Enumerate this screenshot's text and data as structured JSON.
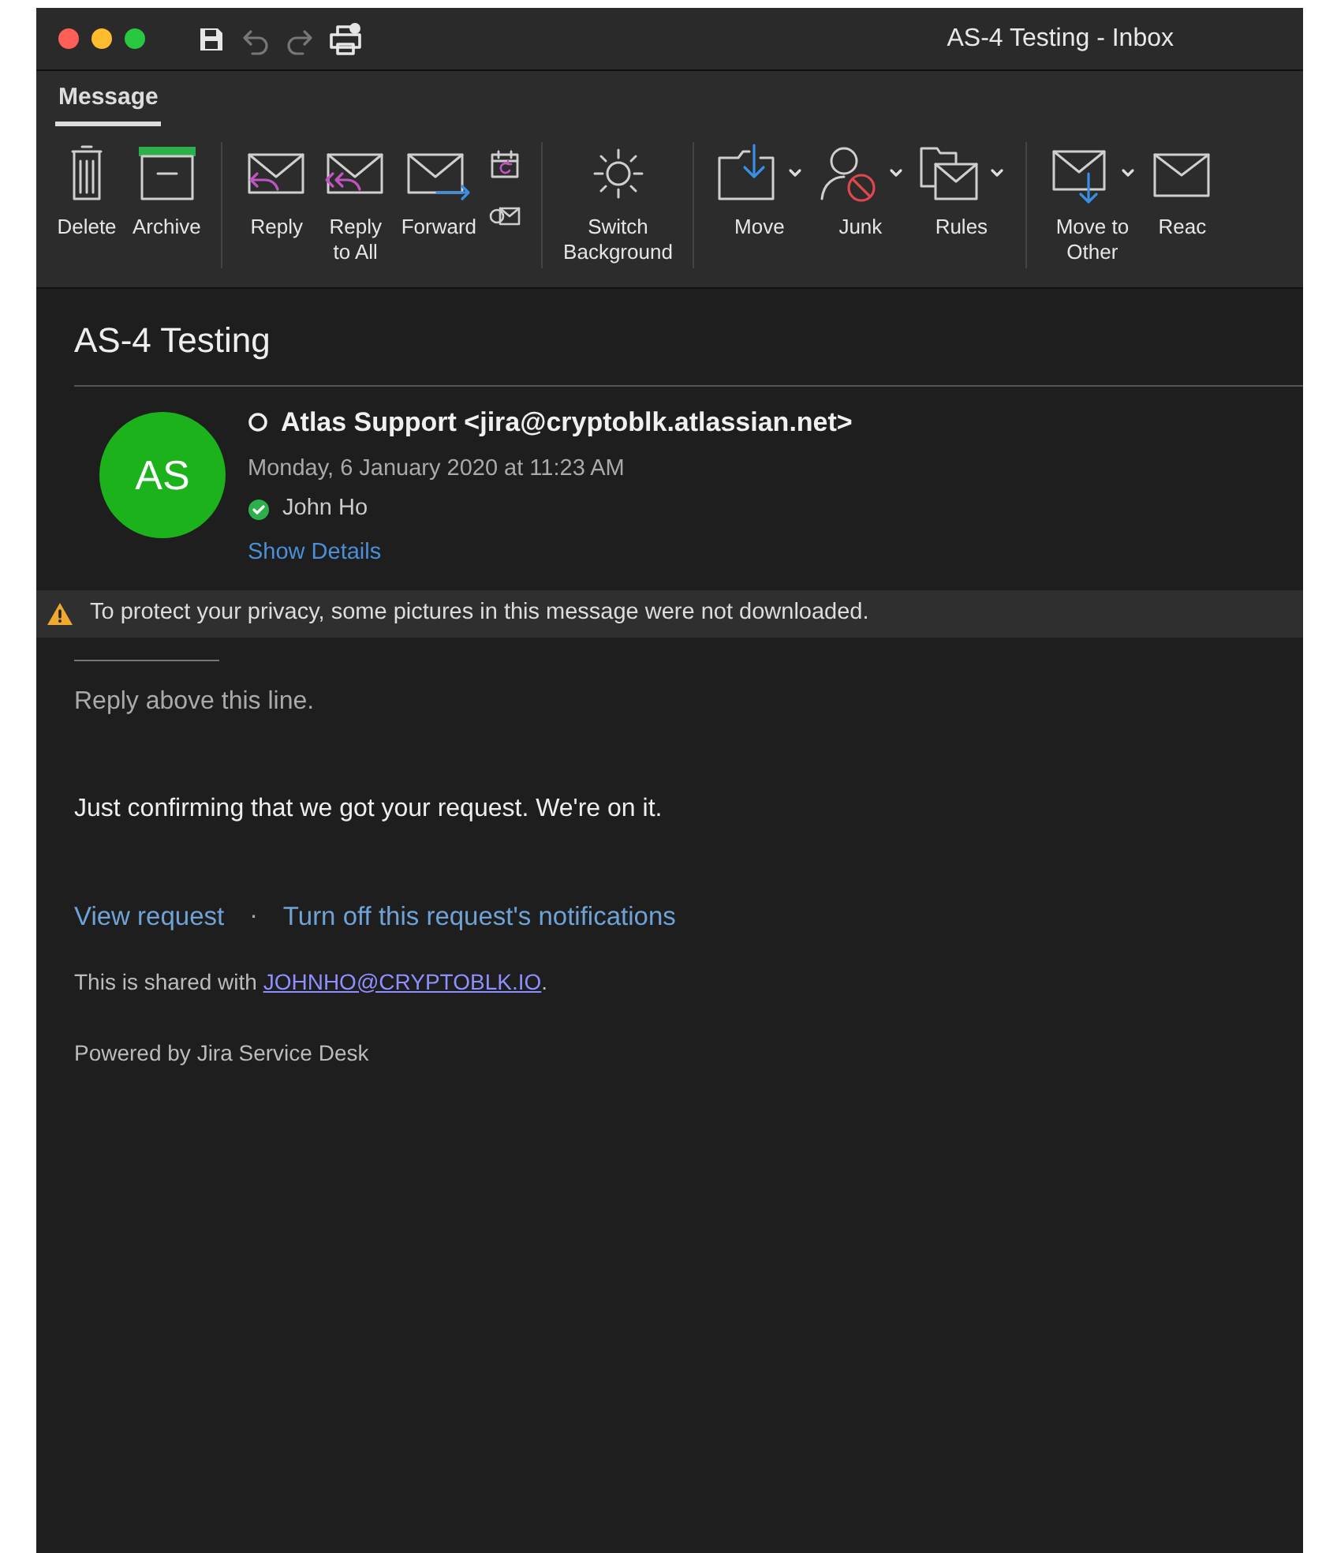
{
  "window": {
    "title": "AS-4 Testing - Inbox"
  },
  "ribbon_tabs": [
    {
      "label": "Message",
      "selected": true
    }
  ],
  "ribbon_groups": [
    {
      "buttons": [
        {
          "kind": "large",
          "label": "Delete",
          "dropdown": false
        },
        {
          "kind": "large",
          "label": "Archive",
          "dropdown": false
        }
      ]
    },
    {
      "buttons": [
        {
          "kind": "large",
          "label": "Reply",
          "dropdown": false
        },
        {
          "kind": "large",
          "label": "Reply\nto All",
          "dropdown": false
        },
        {
          "kind": "large",
          "label": "Forward",
          "dropdown": false
        },
        {
          "kind": "small"
        },
        {
          "kind": "small"
        }
      ]
    },
    {
      "buttons": [
        {
          "kind": "large",
          "label": "Switch\nBackground",
          "dropdown": false
        }
      ]
    },
    {
      "buttons": [
        {
          "kind": "large",
          "label": "Move",
          "dropdown": true
        },
        {
          "kind": "large",
          "label": "Junk",
          "dropdown": true
        },
        {
          "kind": "large",
          "label": "Rules",
          "dropdown": true
        }
      ]
    },
    {
      "buttons": [
        {
          "kind": "large",
          "label": "Move to\nOther",
          "dropdown": true
        },
        {
          "kind": "large",
          "label": "Reac",
          "dropdown": false
        }
      ]
    }
  ],
  "message": {
    "subject": "AS-4 Testing",
    "avatar_initials": "AS",
    "sender": "Atlas Support <jira@cryptoblk.atlassian.net>",
    "unread": false,
    "date": "Monday, 6 January 2020 at 11:23 AM",
    "recipient": "John Ho",
    "show_details": "Show Details"
  },
  "privacy_notice": "To protect your privacy, some pictures in this message were not downloaded.",
  "body": {
    "reply_hint": "Reply above this line.",
    "text": "Just confirming that we got your request. We're on it.",
    "links": [
      "View request",
      "Turn off this request's notifications"
    ],
    "link_separator": "·",
    "shared_text": "This is shared with",
    "shared_email": "JOHNHO@CRYPTOBLK.IO",
    "shared_end": ".",
    "footer": "Powered by Jira Service Desk"
  }
}
